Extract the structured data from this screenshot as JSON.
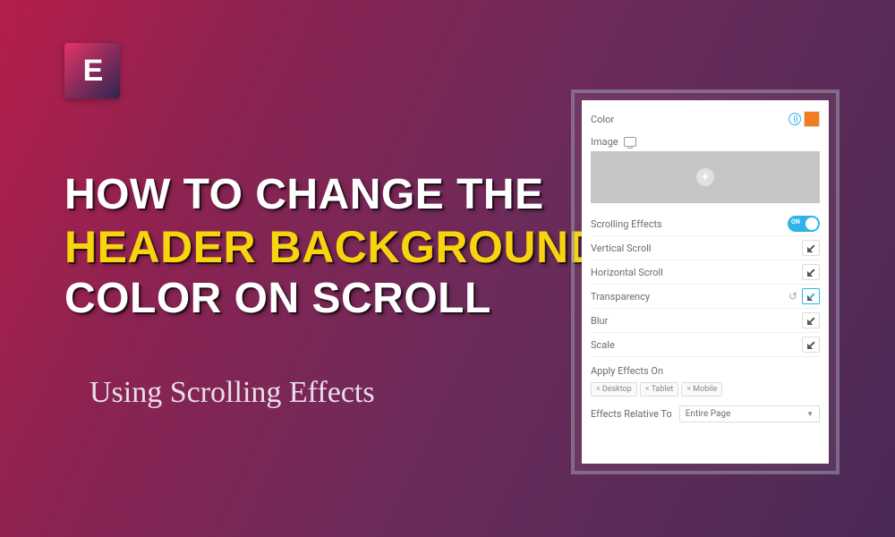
{
  "logo": {
    "letter": "E"
  },
  "headline": {
    "line1": "How to Change the",
    "line2": "Header Background",
    "line3": "Color on Scroll"
  },
  "subtitle": "Using Scrolling Effects",
  "panel": {
    "color_label": "Color",
    "color_value": "#f47c20",
    "image_label": "Image",
    "scrolling_effects": {
      "label": "Scrolling Effects",
      "state": "ON"
    },
    "effects": [
      {
        "label": "Vertical Scroll",
        "active": false,
        "reset": false
      },
      {
        "label": "Horizontal Scroll",
        "active": false,
        "reset": false
      },
      {
        "label": "Transparency",
        "active": true,
        "reset": true
      },
      {
        "label": "Blur",
        "active": false,
        "reset": false
      },
      {
        "label": "Scale",
        "active": false,
        "reset": false
      }
    ],
    "apply_label": "Apply Effects On",
    "tags": [
      "Desktop",
      "Tablet",
      "Mobile"
    ],
    "relative_label": "Effects Relative To",
    "relative_value": "Entire Page"
  }
}
